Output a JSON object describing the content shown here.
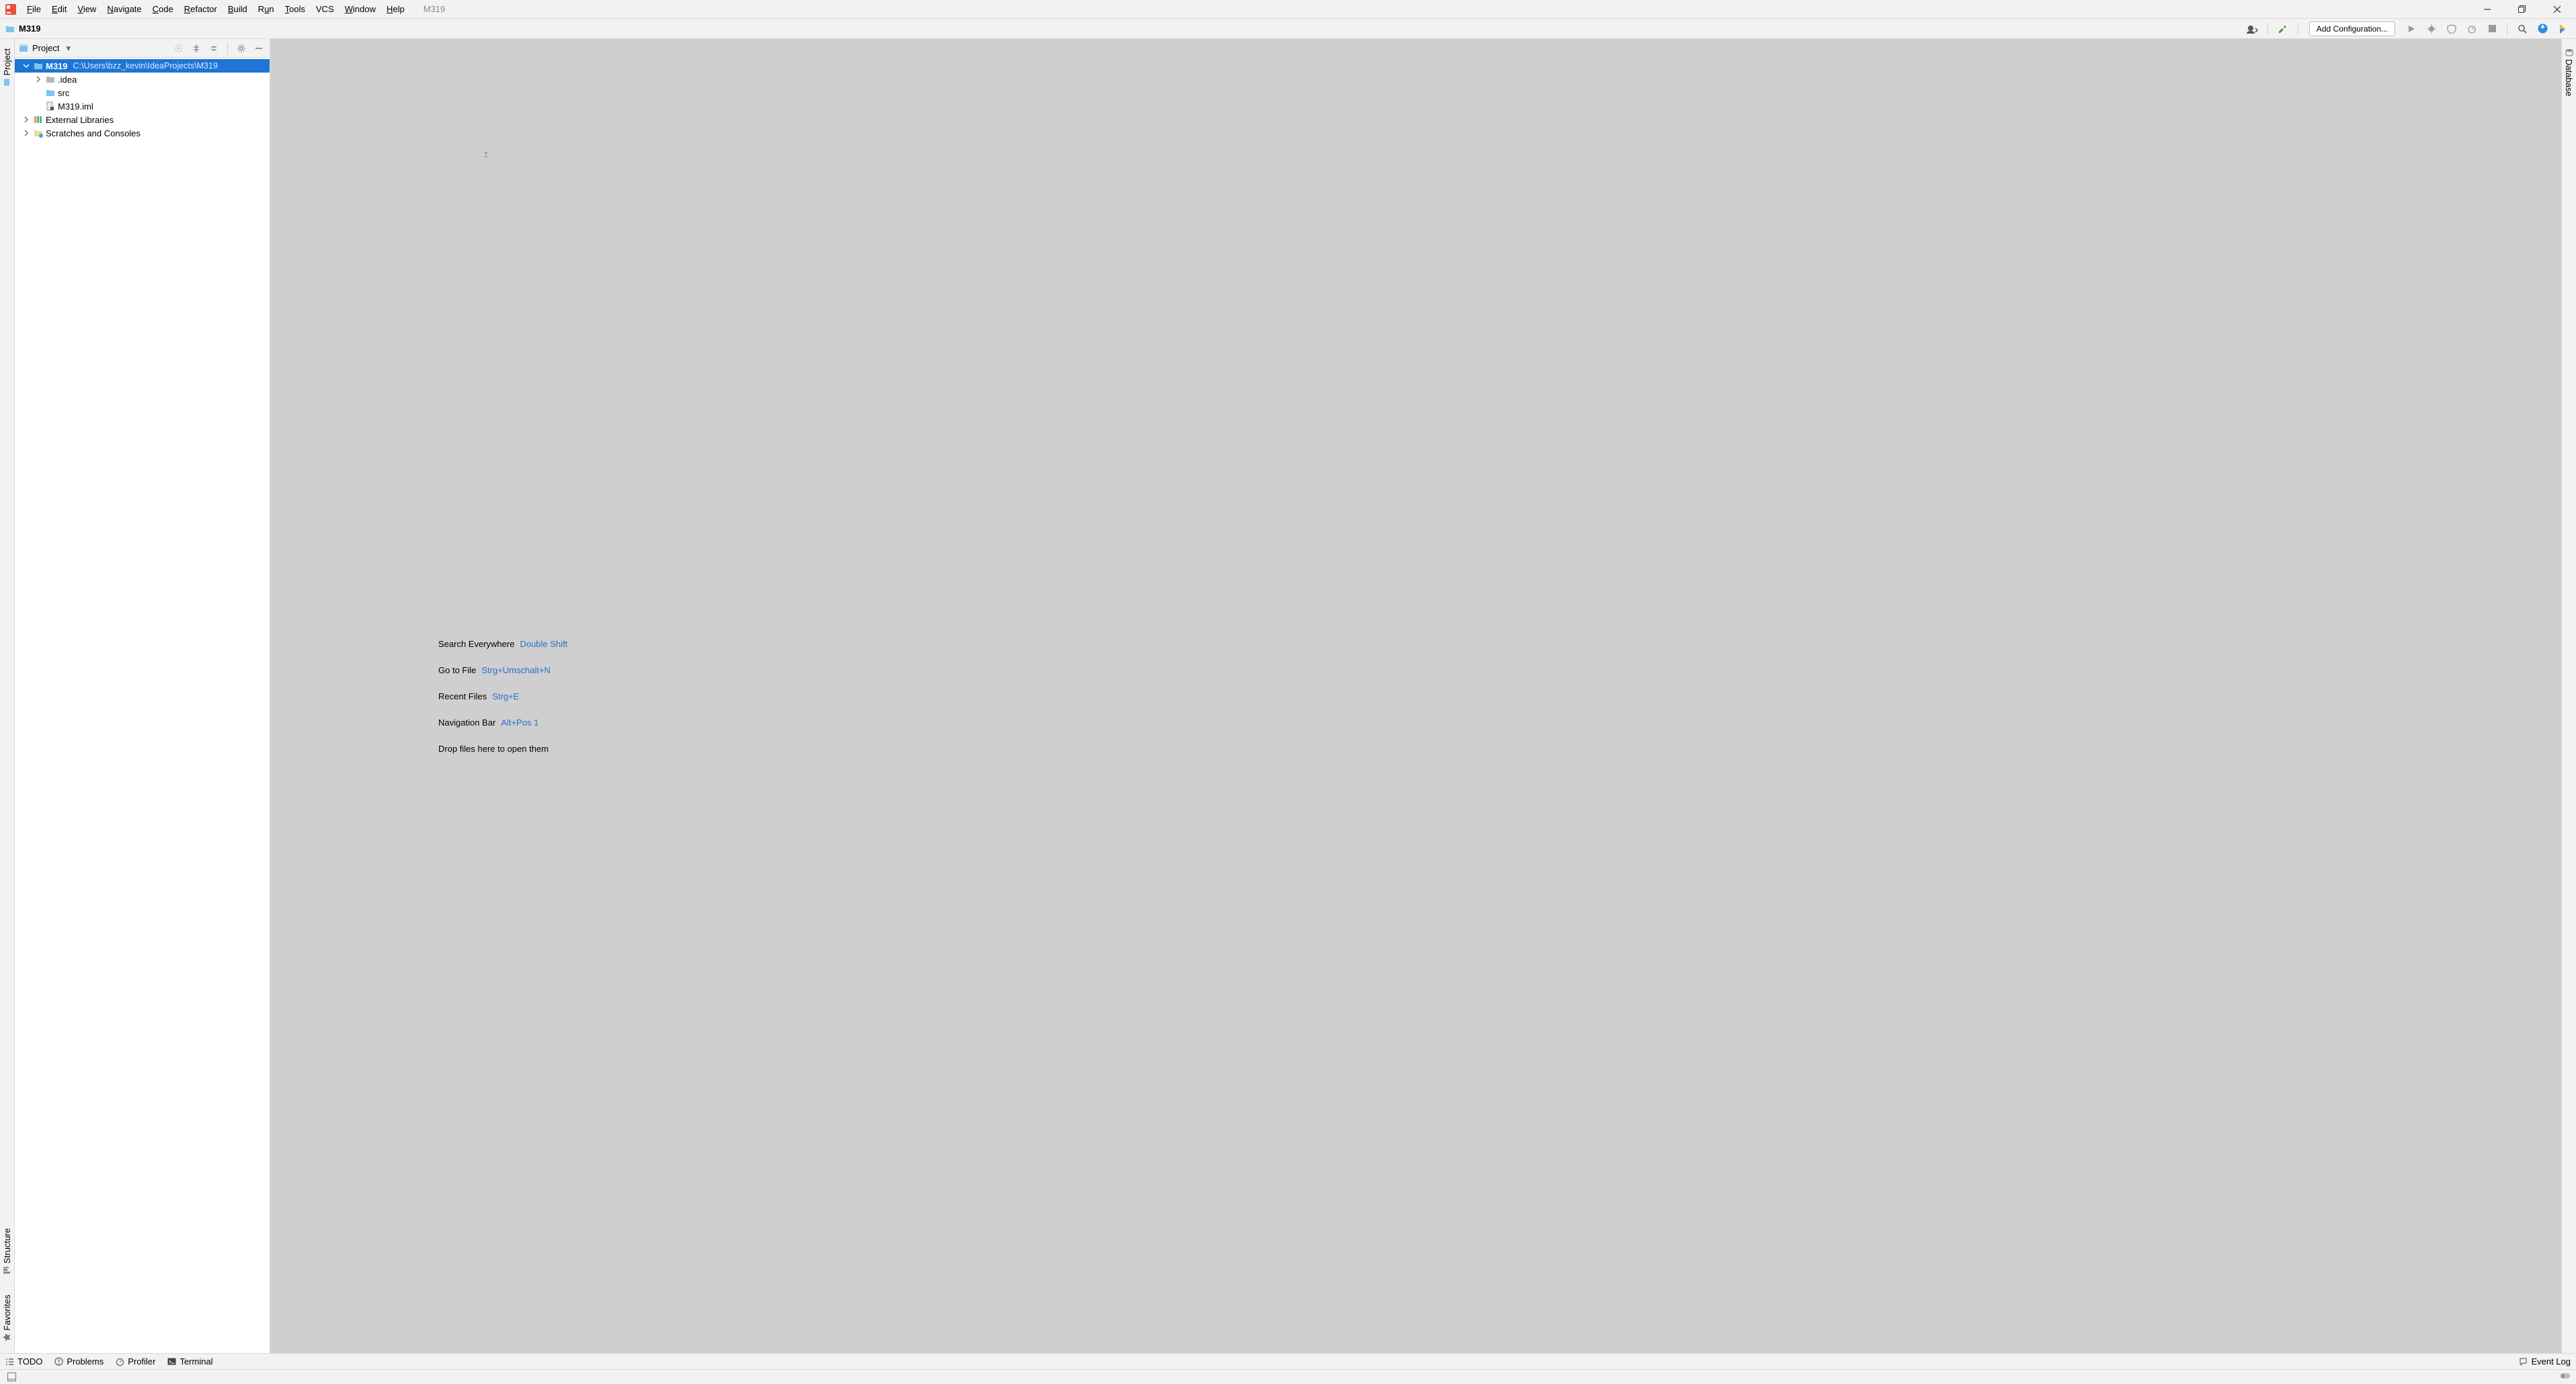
{
  "window": {
    "title_hint": "M319"
  },
  "menu": {
    "file": "File",
    "edit": "Edit",
    "view": "View",
    "navigate": "Navigate",
    "code": "Code",
    "refactor": "Refactor",
    "build": "Build",
    "run": "Run",
    "tools": "Tools",
    "vcs": "VCS",
    "window": "Window",
    "help": "Help"
  },
  "breadcrumb": {
    "project": "M319"
  },
  "toolbar": {
    "add_configuration": "Add Configuration..."
  },
  "left_rail": {
    "project": "Project",
    "structure": "Structure",
    "favorites": "Favorites"
  },
  "right_rail": {
    "database": "Database"
  },
  "project_pane": {
    "title": "Project",
    "root": {
      "name": "M319",
      "path": "C:\\Users\\bzz_kevin\\IdeaProjects\\M319"
    },
    "children": {
      "idea": ".idea",
      "src": "src",
      "iml": "M319.iml"
    },
    "external_libraries": "External Libraries",
    "scratches": "Scratches and Consoles"
  },
  "editor_hints": {
    "search_label": "Search Everywhere",
    "search_key": "Double Shift",
    "goto_label": "Go to File",
    "goto_key": "Strg+Umschalt+N",
    "recent_label": "Recent Files",
    "recent_key": "Strg+E",
    "navbar_label": "Navigation Bar",
    "navbar_key": "Alt+Pos 1",
    "drop": "Drop files here to open them"
  },
  "bottom_tabs": {
    "todo": "TODO",
    "problems": "Problems",
    "profiler": "Profiler",
    "terminal": "Terminal",
    "event_log": "Event Log"
  }
}
